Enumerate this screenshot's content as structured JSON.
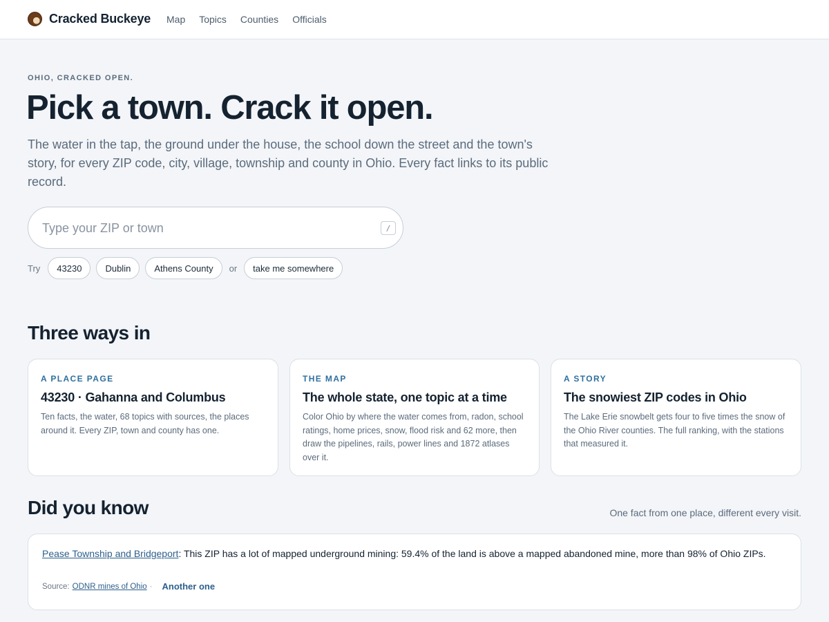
{
  "header": {
    "brand": "Cracked Buckeye",
    "nav": [
      "Map",
      "Topics",
      "Counties",
      "Officials"
    ]
  },
  "hero": {
    "eyebrow": "OHIO, CRACKED OPEN.",
    "title": "Pick a town. Crack it open.",
    "lede": "The water in the tap, the ground under the house, the school down the street and the town's story, for every ZIP code, city, village, township and county in Ohio. Every fact links to its public record.",
    "search_placeholder": "Type your ZIP or town",
    "search_shortcut": "/",
    "try_label": "Try",
    "try_chips": [
      "43230",
      "Dublin",
      "Athens County"
    ],
    "or_label": "or",
    "random_chip": "take me somewhere"
  },
  "ways": {
    "title": "Three ways in",
    "cards": [
      {
        "kicker": "A PLACE PAGE",
        "title": "43230 · Gahanna and Columbus",
        "body": "Ten facts, the water, 68 topics with sources, the places around it. Every ZIP, town and county has one."
      },
      {
        "kicker": "THE MAP",
        "title": "The whole state, one topic at a time",
        "body": "Color Ohio by where the water comes from, radon, school ratings, home prices, snow, flood risk and 62 more, then draw the pipelines, rails, power lines and 1872 atlases over it."
      },
      {
        "kicker": "A STORY",
        "title": "The snowiest ZIP codes in Ohio",
        "body": "The Lake Erie snowbelt gets four to five times the snow of the Ohio River counties. The full ranking, with the stations that measured it."
      }
    ]
  },
  "dyk": {
    "title": "Did you know",
    "subtitle": "One fact from one place, different every visit.",
    "place_link": "Pease Township and Bridgeport",
    "fact": ": This ZIP has a lot of mapped underground mining: 59.4% of the land is above a mapped abandoned mine, more than 98% of Ohio ZIPs.",
    "source_label": "Source:",
    "source_link": "ODNR mines of Ohio",
    "separator": "·",
    "another": "Another one"
  }
}
